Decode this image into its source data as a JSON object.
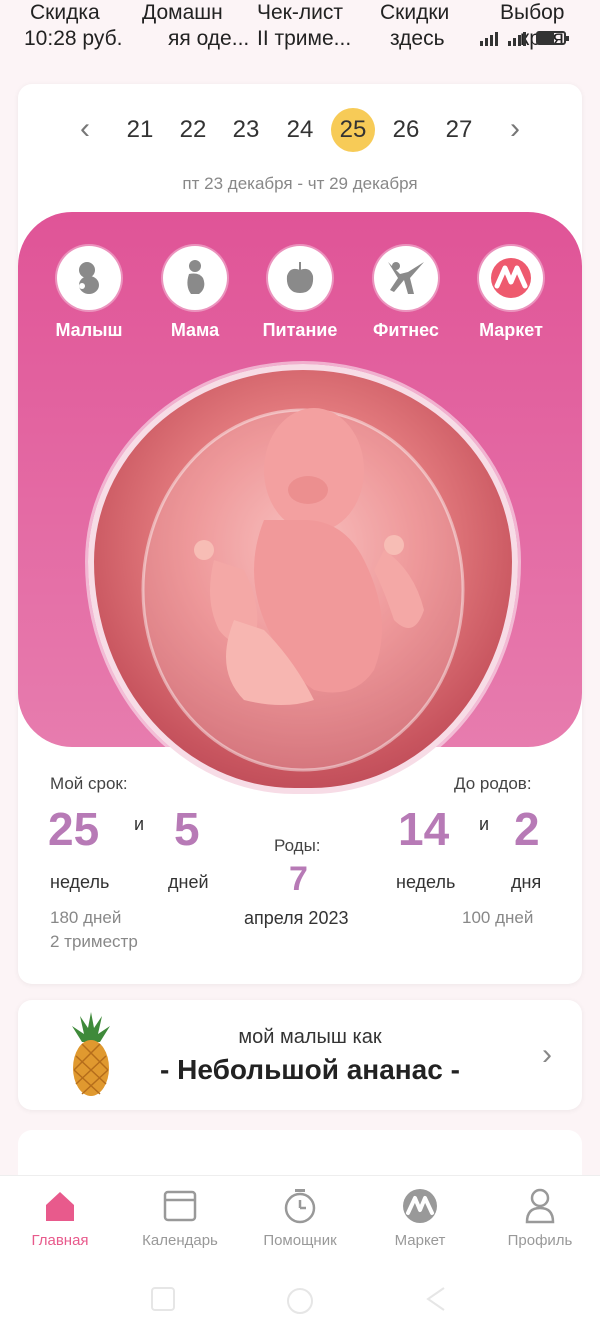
{
  "status_bar": {
    "tabs": [
      "Скидка",
      "Домашн",
      "Чек-лист",
      "Скидки",
      "Выбор"
    ],
    "subtabs": [
      "10:28 руб.",
      "яя оде...",
      "II триме...",
      "здесь",
      "кроя"
    ]
  },
  "week_nav": {
    "days": [
      "21",
      "22",
      "23",
      "24",
      "25",
      "26",
      "27"
    ],
    "active_day": "25",
    "range": "пт 23 декабря - чт 29 декабря"
  },
  "categories": [
    {
      "label": "Малыш",
      "icon": "baby-icon"
    },
    {
      "label": "Мама",
      "icon": "mother-icon"
    },
    {
      "label": "Питание",
      "icon": "apple-icon"
    },
    {
      "label": "Фитнес",
      "icon": "fitness-icon"
    },
    {
      "label": "Маркет",
      "icon": "market-logo-icon"
    }
  ],
  "stats": {
    "term_label": "Мой срок:",
    "weeks": "25",
    "and1": "и",
    "days": "5",
    "weeks_unit": "недель",
    "days_unit": "дней",
    "total_days": "180 дней",
    "trimester": "2 триместр",
    "birth_label": "Роды:",
    "birth_day": "7",
    "birth_month": "апреля 2023",
    "left_label": "До родов:",
    "left_weeks": "14",
    "and2": "и",
    "left_days": "2",
    "left_weeks_unit": "недель",
    "left_days_unit": "дня",
    "left_total": "100 дней"
  },
  "baby_size": {
    "intro": "мой малыш как",
    "fruit": "- Небольшой ананас -"
  },
  "bottom_nav": [
    {
      "label": "Главная",
      "icon": "home-icon",
      "active": true
    },
    {
      "label": "Календарь",
      "icon": "calendar-icon",
      "active": false
    },
    {
      "label": "Помощник",
      "icon": "timer-icon",
      "active": false
    },
    {
      "label": "Маркет",
      "icon": "market-logo-icon",
      "active": false
    },
    {
      "label": "Профиль",
      "icon": "profile-icon",
      "active": false
    }
  ],
  "colors": {
    "accent_pink": "#e05497",
    "number_purple": "#b77ab6",
    "active_day": "#f7cb57",
    "nav_active": "#e85a8c"
  }
}
